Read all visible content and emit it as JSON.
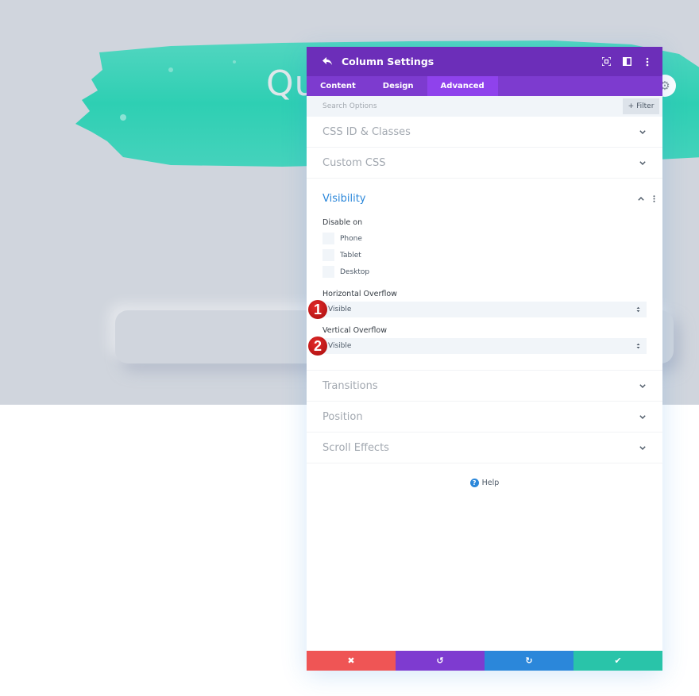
{
  "background": {
    "hero_title_partial": "Qu",
    "colors": {
      "page_top": "#d0d5dd",
      "brush": "#2ecfb3",
      "page_bottom": "#ffffff"
    }
  },
  "panel": {
    "title": "Column Settings",
    "header_icons": [
      "back-icon",
      "fullscreen-icon",
      "split-view-icon",
      "more-options-icon"
    ],
    "tabs": [
      {
        "label": "Content",
        "active": false
      },
      {
        "label": "Design",
        "active": false
      },
      {
        "label": "Advanced",
        "active": true
      }
    ],
    "search": {
      "placeholder": "Search Options",
      "value": ""
    },
    "filter_label": "Filter",
    "sections_before": [
      {
        "title": "CSS ID & Classes",
        "expanded": false
      },
      {
        "title": "Custom CSS",
        "expanded": false
      }
    ],
    "visibility": {
      "title": "Visibility",
      "expanded": true,
      "disable_on_label": "Disable on",
      "devices": [
        {
          "label": "Phone",
          "checked": false
        },
        {
          "label": "Tablet",
          "checked": false
        },
        {
          "label": "Desktop",
          "checked": false
        }
      ],
      "horizontal_overflow": {
        "label": "Horizontal Overflow",
        "value": "Visible",
        "annotation": "1"
      },
      "vertical_overflow": {
        "label": "Vertical Overflow",
        "value": "Visible",
        "annotation": "2"
      }
    },
    "sections_after": [
      {
        "title": "Transitions",
        "expanded": false
      },
      {
        "title": "Position",
        "expanded": false
      },
      {
        "title": "Scroll Effects",
        "expanded": false
      }
    ],
    "help_label": "Help",
    "footer": {
      "discard_icon": "✖",
      "undo_icon": "↺",
      "redo_icon": "↻",
      "save_icon": "✔"
    },
    "colors": {
      "header": "#6c2eb9",
      "tabs": "#7d3bcf",
      "active_tab": "#8f42ec",
      "accent": "#2b87da",
      "discard": "#ef5555",
      "undo": "#7e3bd0",
      "redo": "#2b87da",
      "save": "#29c4a9",
      "annotation": "#c41414"
    }
  }
}
